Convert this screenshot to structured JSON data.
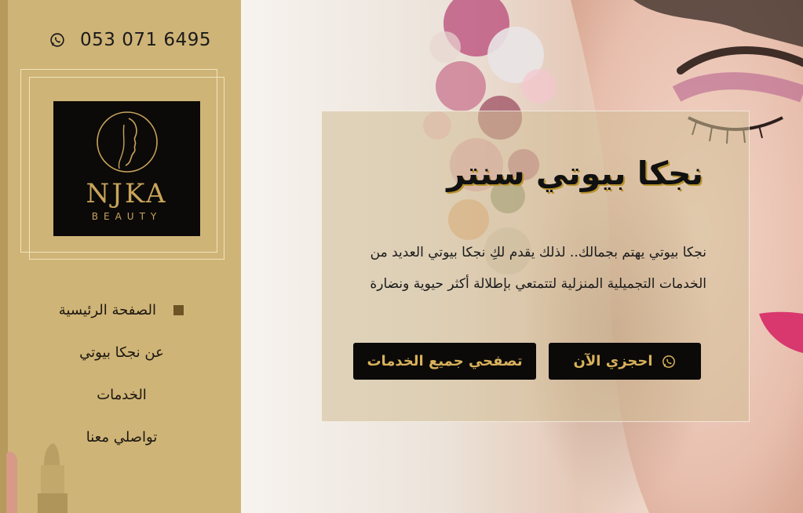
{
  "header": {
    "phone": "053 071 6495",
    "phone_icon": "whatsapp-icon"
  },
  "logo": {
    "name": "NJKA",
    "sub": "BEAUTY"
  },
  "nav": {
    "items": [
      {
        "label": "الصفحة الرئيسية",
        "active": true
      },
      {
        "label": "عن نجكا بيوتي",
        "active": false
      },
      {
        "label": "الخدمات",
        "active": false
      },
      {
        "label": "تواصلي معنا",
        "active": false
      }
    ]
  },
  "hero": {
    "title": "نجكا بيوتي سنتر",
    "description": "نجكا بيوتي يهتم بجمالك.. لذلك يقدم لكِ نجكا بيوتي العديد من الخدمات التجميلية المنزلية لتتمتعي بإطلالة أكثر حيوية ونضارة",
    "book_button": "احجزي الآن",
    "book_icon": "whatsapp-icon",
    "services_button": "تصفحي جميع الخدمات"
  },
  "colors": {
    "sidebar": "#cfb477",
    "accent_gold": "#d8b15c",
    "button_bg": "#0b0a09",
    "logo_bg": "#0b0a09"
  }
}
